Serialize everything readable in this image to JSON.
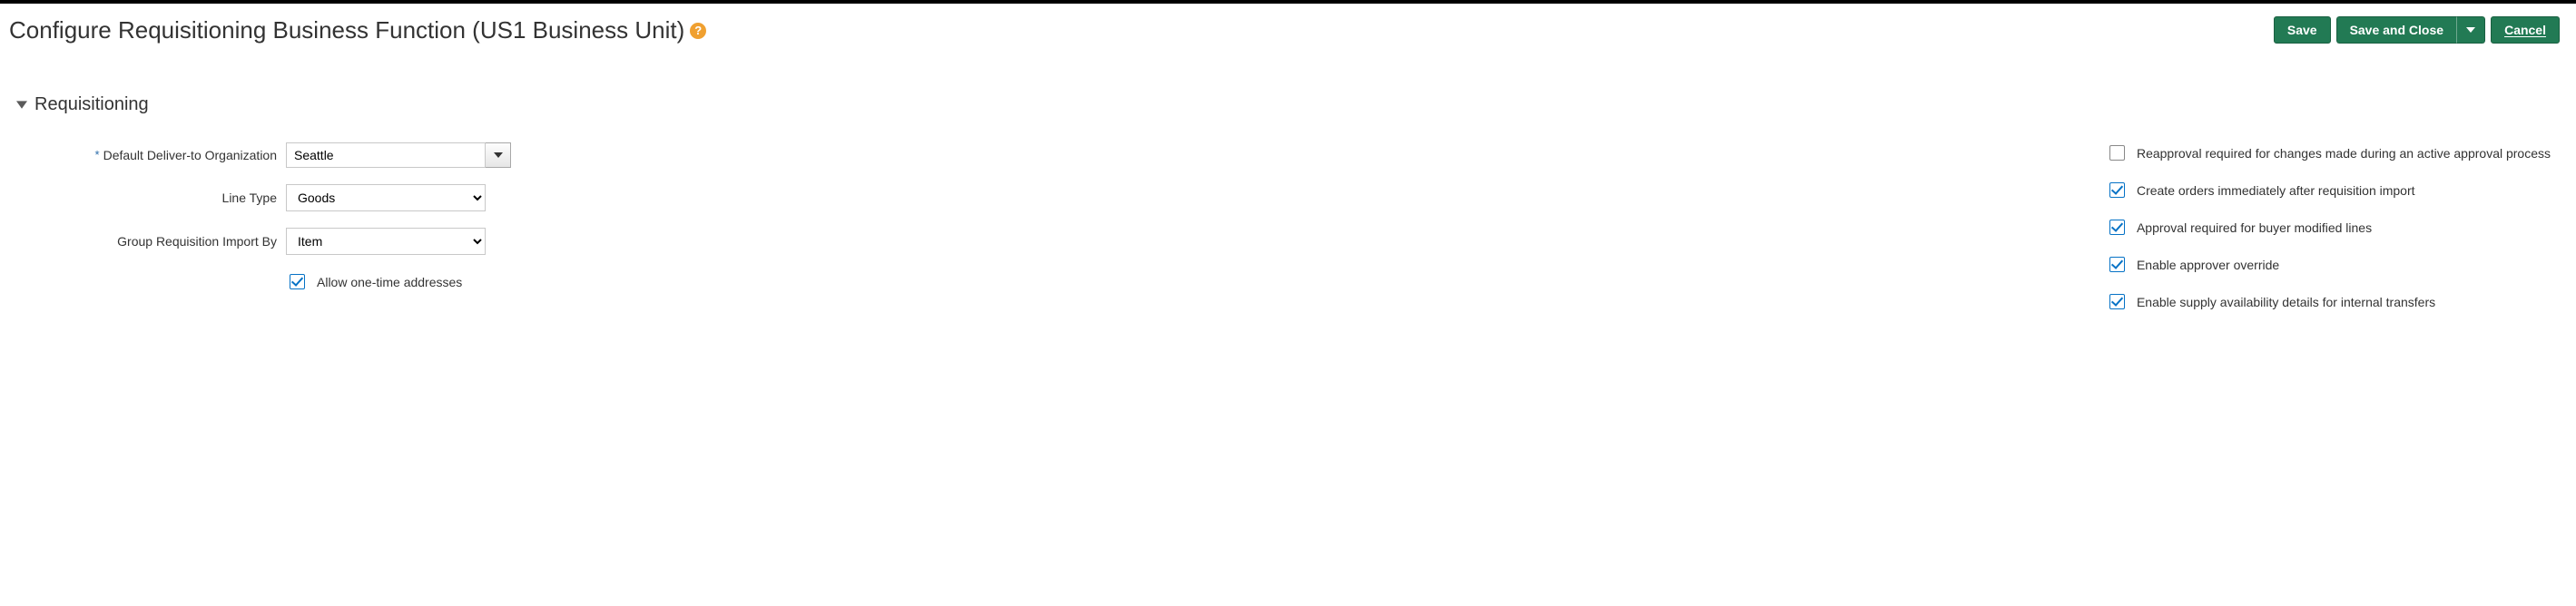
{
  "header": {
    "title": "Configure Requisitioning Business Function (US1 Business Unit)",
    "buttons": {
      "save": "Save",
      "save_and_close": "Save and Close",
      "cancel": "Cancel"
    }
  },
  "section": {
    "title": "Requisitioning"
  },
  "fields": {
    "deliver_to": {
      "label": "Default Deliver-to Organization",
      "value": "Seattle"
    },
    "line_type": {
      "label": "Line Type",
      "value": "Goods"
    },
    "group_import": {
      "label": "Group Requisition Import By",
      "value": "Item"
    },
    "allow_one_time": {
      "label": "Allow one-time addresses",
      "checked": true
    }
  },
  "checks": {
    "reapproval": {
      "label": "Reapproval required for changes made during an active approval process",
      "checked": false
    },
    "create_orders": {
      "label": "Create orders immediately after requisition import",
      "checked": true
    },
    "approval_buyer": {
      "label": "Approval required for buyer modified lines",
      "checked": true
    },
    "approver_override": {
      "label": "Enable approver override",
      "checked": true
    },
    "supply_avail": {
      "label": "Enable supply availability details for internal transfers",
      "checked": true
    }
  }
}
